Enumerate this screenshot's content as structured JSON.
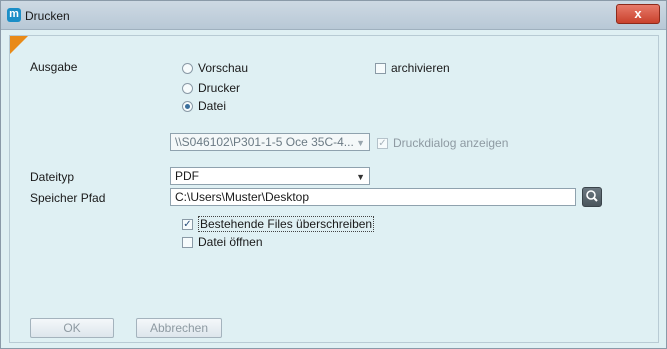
{
  "window": {
    "title": "Drucken",
    "app_icon_letter": "m",
    "close_label": "x"
  },
  "ausgabe": {
    "label": "Ausgabe",
    "options": [
      {
        "label": "Vorschau",
        "checked": false
      },
      {
        "label": "Drucker",
        "checked": false
      },
      {
        "label": "Datei",
        "checked": true
      }
    ],
    "archivieren": {
      "label": "archivieren",
      "checked": false
    }
  },
  "printer": {
    "selected": "\\\\S046102\\P301-1-5  Oce 35C-4...",
    "druckdialog": {
      "label": "Druckdialog anzeigen",
      "checked": true,
      "disabled": true
    }
  },
  "dateityp": {
    "label": "Dateityp",
    "selected": "PDF"
  },
  "speicher_pfad": {
    "label": "Speicher Pfad",
    "value": "C:\\Users\\Muster\\Desktop"
  },
  "options": {
    "overwrite": {
      "label": "Bestehende Files überschreiben",
      "checked": true
    },
    "open_file": {
      "label": "Datei öffnen",
      "checked": false
    }
  },
  "buttons": {
    "ok": "OK",
    "cancel": "Abbrechen"
  },
  "colors": {
    "dialog_bg": "#dff0f3",
    "accent": "#e98a17",
    "close": "#c9412c"
  }
}
